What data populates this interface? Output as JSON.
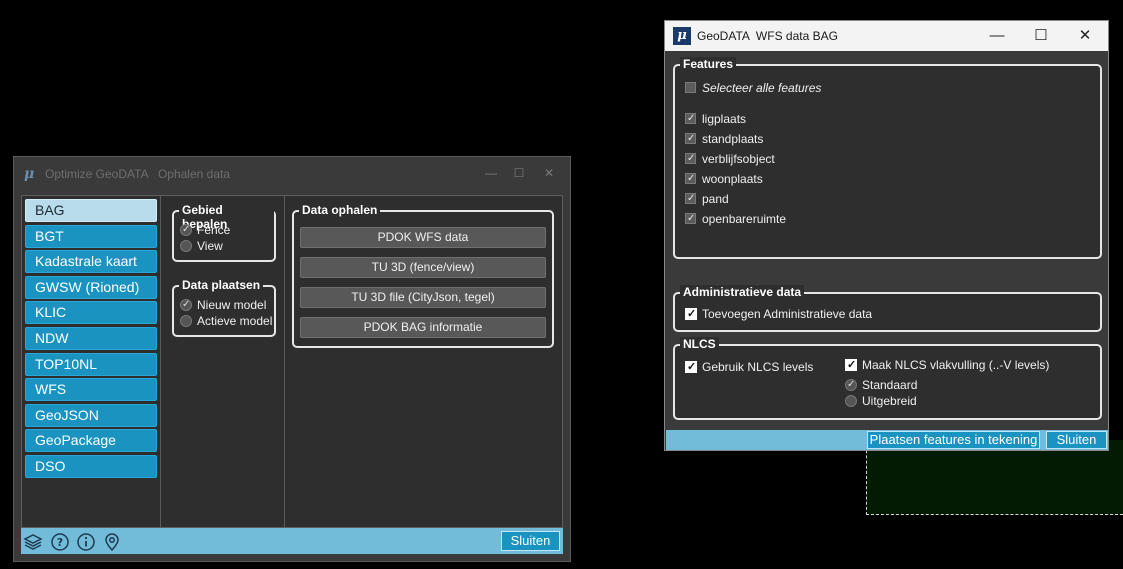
{
  "win1": {
    "title_app": "Optimize GeoDATA",
    "title_page": "Ophalen data",
    "nav": [
      {
        "label": "BAG",
        "selected": true
      },
      {
        "label": "BGT"
      },
      {
        "label": "Kadastrale kaart"
      },
      {
        "label": "GWSW (Rioned)"
      },
      {
        "label": "KLIC"
      },
      {
        "label": "NDW"
      },
      {
        "label": "TOP10NL"
      },
      {
        "label": "WFS"
      },
      {
        "label": "GeoJSON"
      },
      {
        "label": "GeoPackage"
      },
      {
        "label": "DSO"
      }
    ],
    "gebied": {
      "legend": "Gebied bepalen",
      "options": [
        "Fence",
        "View"
      ],
      "selected": "Fence"
    },
    "plaatsen": {
      "legend": "Data plaatsen",
      "options": [
        "Nieuw model",
        "Actieve model"
      ],
      "selected": "Nieuw model"
    },
    "ophalen": {
      "legend": "Data ophalen",
      "buttons": [
        "PDOK WFS data",
        "TU 3D (fence/view)",
        "TU 3D file (CityJson, tegel)",
        "PDOK BAG informatie"
      ]
    },
    "close_label": "Sluiten",
    "footer_icons": [
      "layers-icon",
      "help-icon",
      "info-icon",
      "location-pin-icon"
    ]
  },
  "win2": {
    "title_app": "GeoDATA",
    "title_page": "WFS data BAG",
    "features": {
      "legend": "Features",
      "select_all": "Selecteer alle features",
      "items": [
        "ligplaats",
        "standplaats",
        "verblijfsobject",
        "woonplaats",
        "pand",
        "openbareruimte"
      ]
    },
    "admin": {
      "legend": "Administratieve data",
      "checkbox": "Toevoegen Administratieve data"
    },
    "nlcs": {
      "legend": "NLCS",
      "use_levels": "Gebruik NLCS levels",
      "fill": "Maak NLCS vlakvulling (..-V levels)",
      "options": [
        "Standaard",
        "Uitgebreid"
      ],
      "selected": "Standaard"
    },
    "place_label": "Plaatsen features in tekening",
    "close_label": "Sluiten"
  },
  "colors": {
    "accent": "#1a93c0",
    "footer": "#72bcd9",
    "panel": "#2e2e2e",
    "window": "#3a3a3a"
  }
}
